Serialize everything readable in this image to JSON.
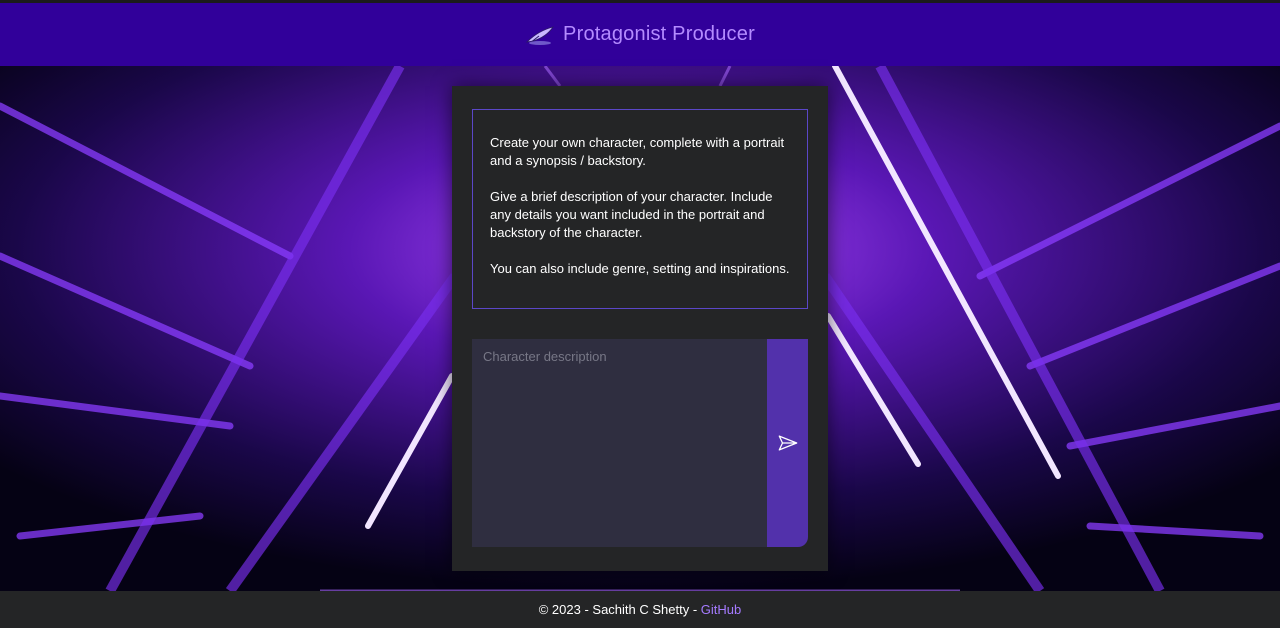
{
  "header": {
    "title": "Protagonist Producer",
    "logo_icon": "quill-icon"
  },
  "intro": {
    "paragraph_1": "Create your own character, complete with a portrait and a synopsis / backstory.",
    "paragraph_2": "Give a brief description of your character. Include any details you want included in the portrait and backstory of the character.",
    "paragraph_3": "You can also include genre, setting and inspirations."
  },
  "composer": {
    "value": "",
    "placeholder": "Character description",
    "send_icon": "send-icon"
  },
  "footer": {
    "copyright": "© 2023 - Sachith C Shetty - ",
    "link_text": "GitHub"
  },
  "colors": {
    "header_bg": "#31009a",
    "accent": "#b48bff",
    "card_bg": "#242526",
    "send_button": "#5231ab",
    "border": "#5b47c8"
  }
}
